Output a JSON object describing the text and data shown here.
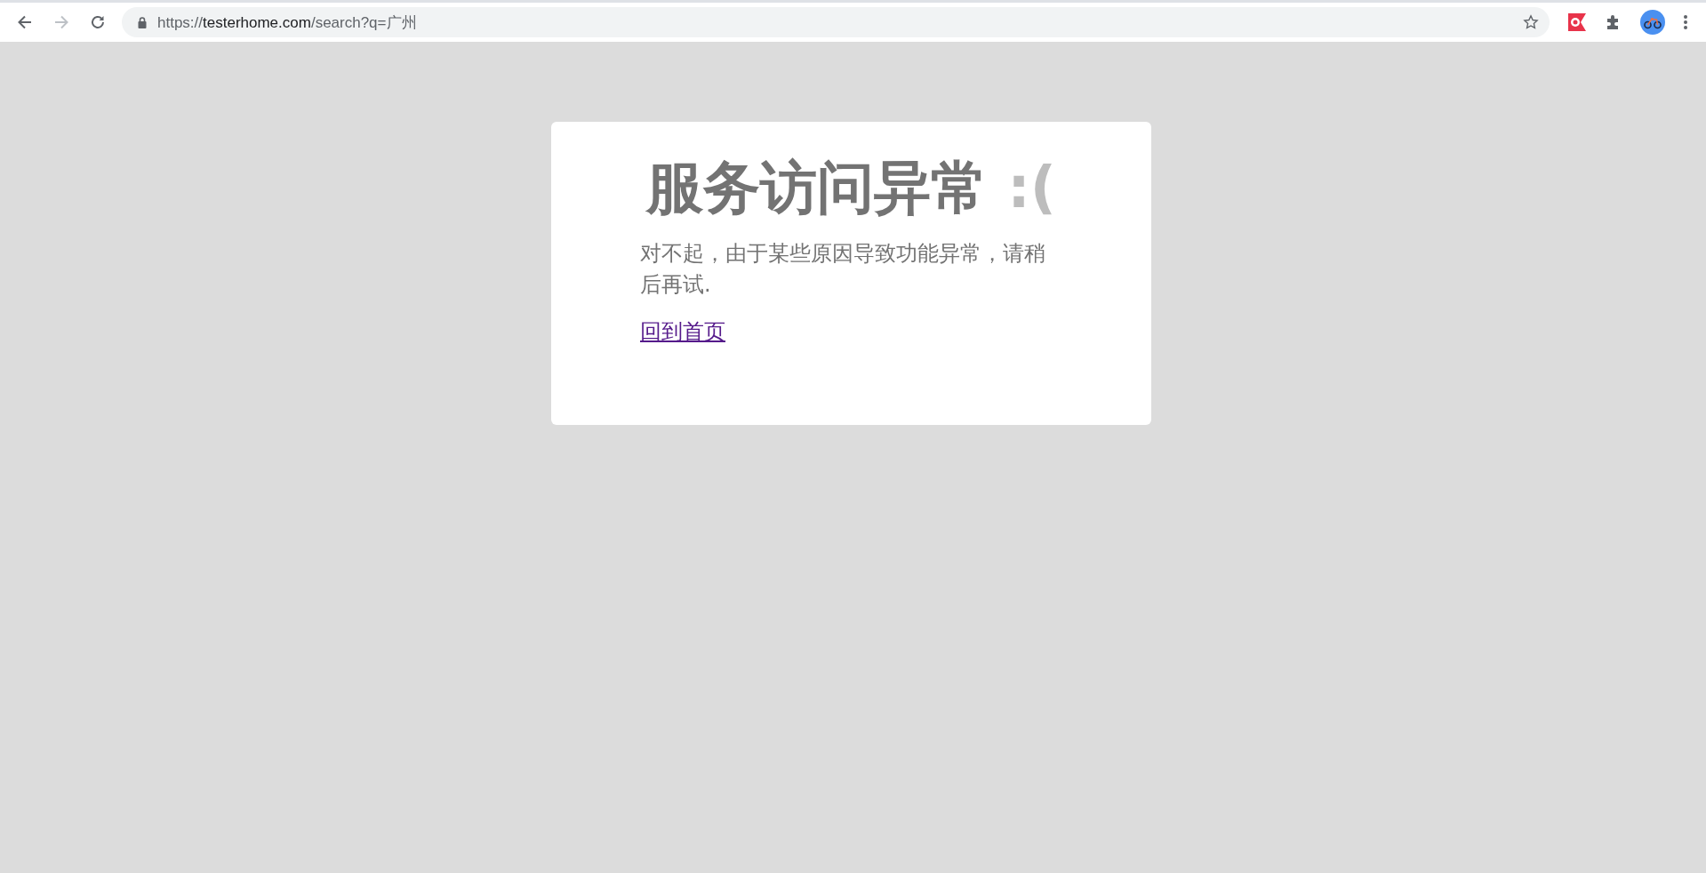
{
  "browser": {
    "back": {
      "disabled": false
    },
    "forward": {
      "disabled": true
    },
    "address": {
      "scheme": "https://",
      "host": "testerhome.com",
      "path": "/search?q=广州"
    },
    "bookmarked": false
  },
  "error_card": {
    "title": "服务访问异常",
    "emoticon": ":(",
    "message": "对不起，由于某些原因导致功能异常，请稍后再试.",
    "link": "回到首页"
  }
}
